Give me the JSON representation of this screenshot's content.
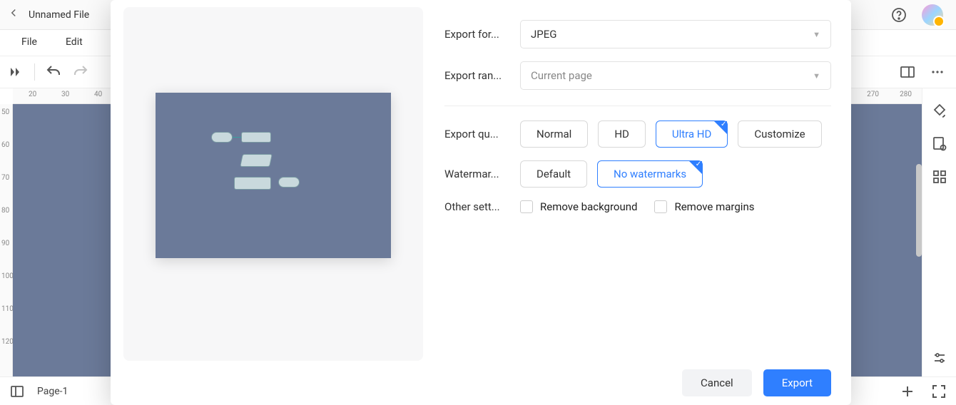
{
  "header": {
    "file_title": "Unnamed File"
  },
  "menu": {
    "file": "File",
    "edit": "Edit"
  },
  "ruler_h": [
    "20",
    "30",
    "40",
    "270",
    "280"
  ],
  "ruler_v": [
    "50",
    "60",
    "70",
    "80",
    "90",
    "100",
    "110",
    "120"
  ],
  "status": {
    "page_label": "Page-1"
  },
  "modal": {
    "labels": {
      "format": "Export for...",
      "range": "Export ran...",
      "quality": "Export qu...",
      "watermark": "Watermar...",
      "other": "Other sett..."
    },
    "format_value": "JPEG",
    "range_value": "Current page",
    "quality_options": {
      "normal": "Normal",
      "hd": "HD",
      "ultra": "Ultra HD",
      "customize": "Customize"
    },
    "watermark_options": {
      "default": "Default",
      "none": "No watermarks"
    },
    "other_options": {
      "remove_bg": "Remove background",
      "remove_margins": "Remove margins"
    },
    "buttons": {
      "cancel": "Cancel",
      "export": "Export"
    }
  }
}
